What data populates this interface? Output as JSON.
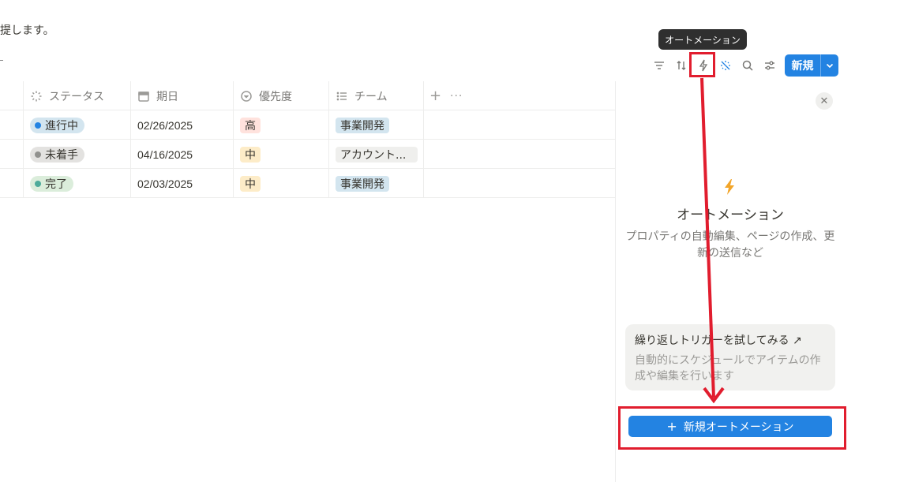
{
  "intro_text": "提します。",
  "tooltip": "オートメーション",
  "toolbar": {
    "icons": [
      "filter-icon",
      "sort-icon",
      "lightning-icon",
      "sparkle-icon",
      "search-icon",
      "settings-icon"
    ],
    "new_label": "新規"
  },
  "table": {
    "headers": [
      "ステータス",
      "期日",
      "優先度",
      "チーム"
    ],
    "rows": [
      {
        "status": "進行中",
        "status_color": "#2383e2",
        "status_bg": "#d3e5ef",
        "date": "02/26/2025",
        "priority": "高",
        "priority_bg": "#ffe2dd",
        "team": "事業開発",
        "team_bg": "#d3e5ef"
      },
      {
        "status": "未着手",
        "status_color": "#91918e",
        "status_bg": "#e3e2e0",
        "date": "04/16/2025",
        "priority": "中",
        "priority_bg": "#fdecc8",
        "team": "アカウント...",
        "team_bg": "#efefed"
      },
      {
        "status": "完了",
        "status_color": "#4dab9a",
        "status_bg": "#dbeddb",
        "date": "02/03/2025",
        "priority": "中",
        "priority_bg": "#fdecc8",
        "team": "事業開発",
        "team_bg": "#d3e5ef"
      }
    ]
  },
  "panel": {
    "title": "オートメーション",
    "description": "プロパティの自動編集、ページの作成、更新の送信など",
    "card_title": "繰り返しトリガーを試してみる ↗",
    "card_desc": "自動的にスケジュールでアイテムの作成や編集を行います",
    "cta_label": "新規オートメーション"
  },
  "colors": {
    "accent": "#2383e2",
    "annotation": "#e11d2e"
  }
}
